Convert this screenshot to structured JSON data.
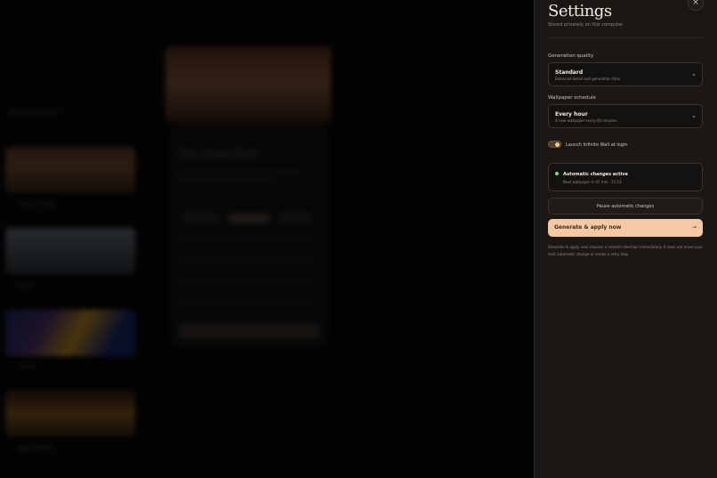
{
  "background": {
    "caption": "All wallpapers",
    "center_title": "The Glass Hall",
    "thumbs": [
      {
        "label": "Autumn Study"
      },
      {
        "label": "Coast"
      },
      {
        "label": "Aurora"
      },
      {
        "label": "Night Market"
      }
    ]
  },
  "settings": {
    "title": "Settings",
    "subtitle": "Stored privately on this computer.",
    "close_icon": "×",
    "generation_quality": {
      "label": "Generation quality",
      "value": "Standard",
      "description": "Balanced detail and generation time",
      "chevron": "⌄"
    },
    "wallpaper_schedule": {
      "label": "Wallpaper schedule",
      "value": "Every hour",
      "description": "A new wallpaper every 60 minutes",
      "chevron": "⌄"
    },
    "launch_toggle": {
      "label": "Launch Infinite Wall at login",
      "checked": true
    },
    "status": {
      "title": "Automatic changes active",
      "description": "Next wallpaper in 47 min · 21:13",
      "dot_color": "#7fd88a"
    },
    "pause_button": "Pause automatic changes",
    "apply_button": {
      "label": "Generate & apply now",
      "arrow": "→",
      "color": "#f4c9a4"
    },
    "note": "Generate & apply now chooses a random direction immediately. It does not move your next automatic change or create a retry loop."
  }
}
